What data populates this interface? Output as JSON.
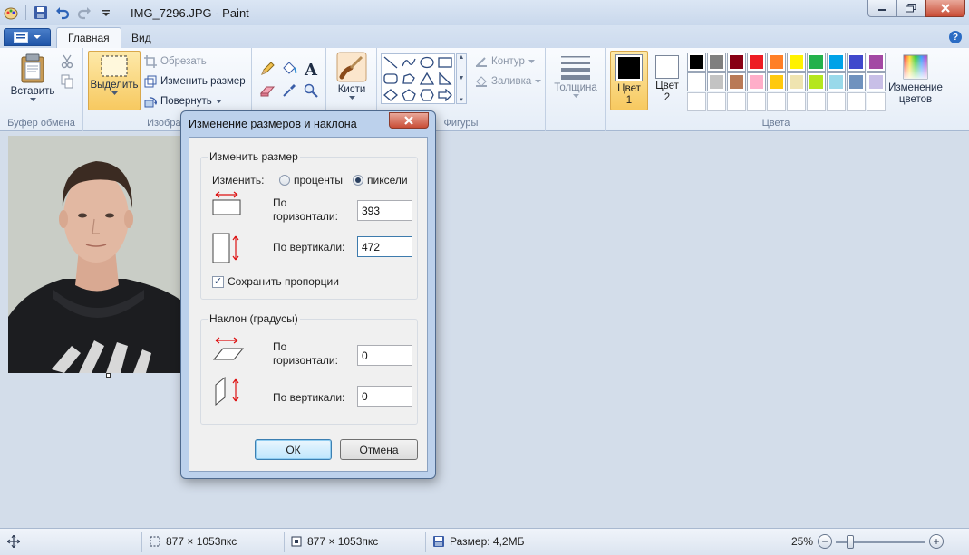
{
  "window": {
    "title": "IMG_7296.JPG - Paint"
  },
  "tabs": {
    "home": "Главная",
    "view": "Вид"
  },
  "ribbon": {
    "clipboard": {
      "paste": "Вставить",
      "group": "Буфер обмена"
    },
    "image": {
      "select": "Выделить",
      "crop": "Обрезать",
      "resize": "Изменить размер",
      "rotate": "Повернуть",
      "group": "Изображ"
    },
    "tools": {
      "brushes": "Кисти"
    },
    "shapes": {
      "outline": "Контур",
      "fill": "Заливка",
      "group": "Фигуры"
    },
    "size": {
      "label": "Толщина"
    },
    "colors": {
      "color1_line1": "Цвет",
      "color1_line2": "1",
      "color2_line1": "Цвет",
      "color2_line2": "2",
      "edit_line1": "Изменение",
      "edit_line2": "цветов",
      "group": "Цвета",
      "color1": "#000000",
      "color2": "#ffffff",
      "palette_row1": [
        "#000000",
        "#7f7f7f",
        "#880015",
        "#ed1c24",
        "#ff7f27",
        "#fff200",
        "#22b14c",
        "#00a2e8",
        "#3f48cc",
        "#a349a4"
      ],
      "palette_row2": [
        "#ffffff",
        "#c3c3c3",
        "#b97a57",
        "#ffaec9",
        "#ffc90e",
        "#efe4b0",
        "#b5e61d",
        "#99d9ea",
        "#7092be",
        "#c8bfe7"
      ],
      "palette_row3": [
        "#ffffff",
        "#ffffff",
        "#ffffff",
        "#ffffff",
        "#ffffff",
        "#ffffff",
        "#ffffff",
        "#ffffff",
        "#ffffff",
        "#ffffff"
      ]
    }
  },
  "dialog": {
    "title": "Изменение размеров и наклона",
    "resize_section": "Изменить размер",
    "by_label": "Изменить:",
    "percent_option": "проценты",
    "pixels_option": "пиксели",
    "selected_unit": "pixels",
    "horizontal_label_line1": "По",
    "horizontal_label_line2": "горизонтали:",
    "horizontal_value": "393",
    "vertical_label": "По вертикали:",
    "vertical_value": "472",
    "keep_ratio": "Сохранить пропорции",
    "keep_ratio_checked": true,
    "skew_section": "Наклон (градусы)",
    "skew_horizontal_line1": "По",
    "skew_horizontal_line2": "горизонтали:",
    "skew_horizontal_value": "0",
    "skew_vertical_label": "По вертикали:",
    "skew_vertical_value": "0",
    "ok": "ОК",
    "cancel": "Отмена"
  },
  "status": {
    "selection_size": "877 × 1053пкс",
    "image_size": "877 × 1053пкс",
    "file_size": "Размер: 4,2МБ",
    "zoom": "25%"
  }
}
